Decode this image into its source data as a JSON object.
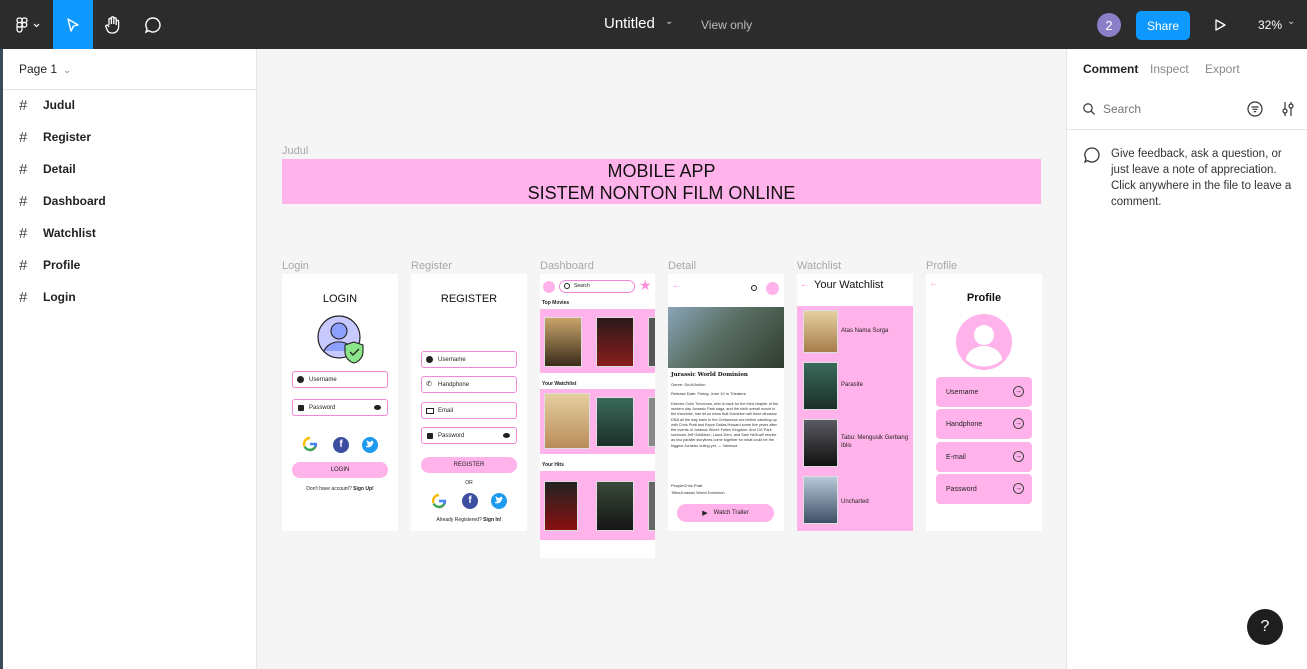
{
  "topbar": {
    "file_title": "Untitled",
    "view_mode": "View only",
    "collaborators_count": "2",
    "share_label": "Share",
    "zoom": "32%"
  },
  "left_panel": {
    "page_selector": "Page 1",
    "layers": [
      "Judul",
      "Register",
      "Detail",
      "Dashboard",
      "Watchlist",
      "Profile",
      "Login"
    ]
  },
  "right_panel": {
    "tabs": [
      "Comment",
      "Inspect",
      "Export"
    ],
    "search_placeholder": "Search",
    "comment_hint": "Give feedback, ask a question, or just leave a note of appreciation. Click anywhere in the file to leave a comment.",
    "help_label": "?"
  },
  "canvas": {
    "frame_labels": {
      "judul": "Judul",
      "login": "Login",
      "register": "Register",
      "dashboard": "Dashboard",
      "detail": "Detail",
      "watchlist": "Watchlist",
      "profile": "Profile"
    },
    "judul": {
      "line1": "MOBILE APP",
      "line2": "SISTEM NONTON FILM ONLINE"
    },
    "login": {
      "title": "LOGIN",
      "username": "Username",
      "password": "Password",
      "button": "LOGIN",
      "footer_text": "Don't have account?",
      "footer_link": "Sign Up!"
    },
    "register": {
      "title": "REGISTER",
      "username": "Username",
      "handphone": "Handphone",
      "email": "Email",
      "password": "Password",
      "button": "REGISTER",
      "or": "OR",
      "footer_text": "Already Registered?",
      "footer_link": "Sign In!"
    },
    "dashboard": {
      "search": "Search",
      "section1": "Top Movies",
      "section2": "Your Watchlist",
      "section3": "Your Hits"
    },
    "detail": {
      "movie_title": "Jurassic World Dominion",
      "genre": "Genre: Sci-fi/Action",
      "release": "Release Date: Friday, June 10 in Theaters",
      "synopsis": "Director Colin Trevorrow, who is back for the third chapter of the modern day Jurassic Park saga, and the sixth overall movie in the franchise, has let us know that Dominion will trace dinosaur DNA all the way back to the Cretaceous era before catching up with Chris Pratt and Bryce Dallas Howard some five years after the events of Jurassic World: Fallen Kingdom. And OG Park survivors Jeff Goldblum, Laura Dern, and Sam Neill will reunite as two parallel storylines come together for what could be the biggest Jurassic outing yet. — Vanessa",
      "people": "PeopleChris Pratt",
      "titles": "TitlesJurassic World Dominion",
      "button": "Watch Trailer"
    },
    "watchlist": {
      "title": "Your Watchlist",
      "items": [
        "Atas Nama Surga",
        "Parasite",
        "Tabu: Mengusik Gerbang Iblis",
        "Uncharted"
      ]
    },
    "profile": {
      "title": "Profile",
      "items": [
        "Username",
        "Handphone",
        "E-mail",
        "Password"
      ]
    }
  },
  "colors": {
    "topbar": "#2c2c2c",
    "accent": "#0d99ff",
    "pink": "#ffb3ea",
    "canvas": "#f5f5f5"
  }
}
